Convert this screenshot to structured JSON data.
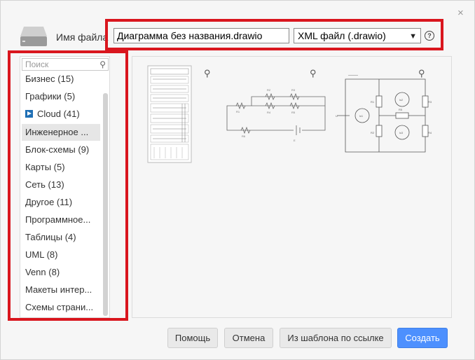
{
  "dialog": {
    "filename_label": "Имя файла",
    "filename_value": "Диаграмма без названия.drawio",
    "format_value": "XML файл (.drawio)",
    "help_glyph": "?",
    "close_glyph": "×"
  },
  "sidebar": {
    "search_placeholder": "Поиск",
    "items": [
      {
        "label": "Бизнес (15)"
      },
      {
        "label": "Графики (5)"
      },
      {
        "label": "Cloud (41)"
      },
      {
        "label": "Инженерное ..."
      },
      {
        "label": "Блок-схемы (9)"
      },
      {
        "label": "Карты (5)"
      },
      {
        "label": "Сеть (13)"
      },
      {
        "label": "Другое (11)"
      },
      {
        "label": "Программное..."
      },
      {
        "label": "Таблицы (4)"
      },
      {
        "label": "UML (8)"
      },
      {
        "label": "Venn (8)"
      },
      {
        "label": "Макеты интер..."
      },
      {
        "label": "Схемы страни..."
      }
    ],
    "selected_index": 3
  },
  "buttons": {
    "help": "Помощь",
    "cancel": "Отмена",
    "from_url": "Из шаблона по ссылке",
    "create": "Создать"
  },
  "colors": {
    "accent": "#4d90fe",
    "highlight": "#d9161e"
  },
  "icons": {
    "search": "search-icon",
    "zoom": "zoom-icon",
    "disk": "disk-icon",
    "cloud": "cloud-icon",
    "help": "help-icon",
    "close": "close-icon"
  }
}
